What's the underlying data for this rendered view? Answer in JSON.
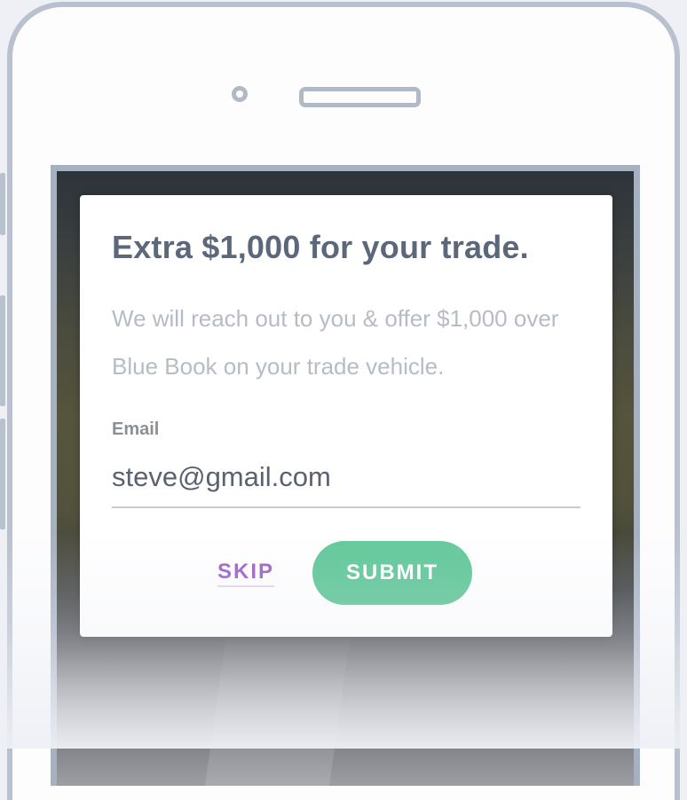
{
  "modal": {
    "title": "Extra $1,000 for your trade.",
    "description": "We will reach out to you & offer $1,000 over Blue Book on your trade vehicle.",
    "email_label": "Email",
    "email_value": "steve@gmail.com",
    "skip_label": "SKIP",
    "submit_label": "SUBMIT"
  },
  "colors": {
    "title": "#5c6779",
    "description": "#b6bcc5",
    "skip": "#9b58c8",
    "submit_bg": "#56c491",
    "phone_frame": "#b9c1ce"
  },
  "icons": {
    "camera": "front-camera-icon",
    "speaker": "speaker-grille-icon"
  }
}
